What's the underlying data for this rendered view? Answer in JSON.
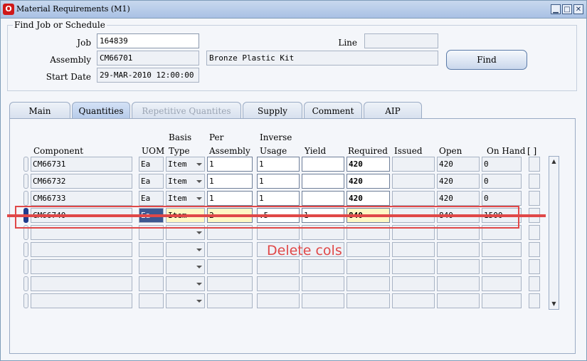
{
  "window": {
    "title": "Material Requirements (M1)",
    "logo": "O",
    "minimize": "▁",
    "maximize": "□",
    "close": "✕"
  },
  "find": {
    "legend": "Find Job or Schedule",
    "job_label": "Job",
    "job_value": "164839",
    "line_label": "Line",
    "line_value": "",
    "assembly_label": "Assembly",
    "assembly_value": "CM66701",
    "assembly_desc": "Bronze Plastic Kit",
    "start_label": "Start Date",
    "start_value": "29-MAR-2010 12:00:00",
    "find_button": "Find"
  },
  "tabs": [
    {
      "label": "Main"
    },
    {
      "label": "Quantities"
    },
    {
      "label": "Repetitive Quantites"
    },
    {
      "label": "Supply"
    },
    {
      "label": "Comment"
    },
    {
      "label": "AIP"
    }
  ],
  "columns": {
    "component": "Component",
    "uom": "UOM",
    "basis_1": "Basis",
    "basis_2": "Type",
    "per_1": "Per",
    "per_2": "Assembly",
    "inverse_1": "Inverse",
    "inverse_2": "Usage",
    "yield": "Yield",
    "required": "Required",
    "issued": "Issued",
    "open": "Open",
    "onhand": "On Hand",
    "flex": "[ ]"
  },
  "rows": [
    {
      "component": "CM66731",
      "uom": "Ea",
      "basis": "Item",
      "per": "1",
      "inverse": "1",
      "yield": "",
      "required": "420",
      "issued": "",
      "open": "420",
      "onhand": "0"
    },
    {
      "component": "CM66732",
      "uom": "Ea",
      "basis": "Item",
      "per": "1",
      "inverse": "1",
      "yield": "",
      "required": "420",
      "issued": "",
      "open": "420",
      "onhand": "0"
    },
    {
      "component": "CM66733",
      "uom": "Ea",
      "basis": "Item",
      "per": "1",
      "inverse": "1",
      "yield": "",
      "required": "420",
      "issued": "",
      "open": "420",
      "onhand": "0"
    },
    {
      "component": "CM66740",
      "uom": "Ea",
      "basis": "Item",
      "per": "2",
      "inverse": ".5",
      "yield": "1",
      "required": "840",
      "issued": "",
      "open": "840",
      "onhand": "1500"
    }
  ],
  "annotation": {
    "text": "Delete cols",
    "color": "#e04848"
  },
  "scrollbar": {
    "up": "▲",
    "down": "▼"
  }
}
